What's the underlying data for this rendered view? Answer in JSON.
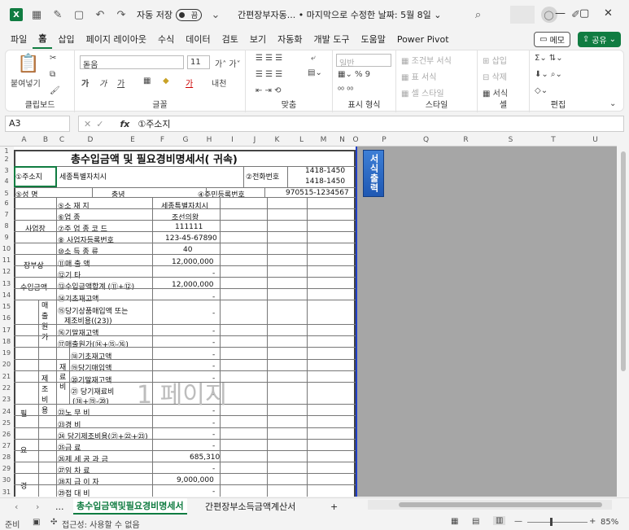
{
  "titlebar": {
    "app_icon": "X",
    "autosave_label": "자동 저장",
    "autosave_state": "끔",
    "doc_title": "간편장부자동... • 마지막으로 수정한 날짜: 5월 8일 ⌄"
  },
  "menu": {
    "tabs": [
      "파일",
      "홈",
      "삽입",
      "페이지 레이아웃",
      "수식",
      "데이터",
      "검토",
      "보기",
      "자동화",
      "개발 도구",
      "도움말",
      "Power Pivot"
    ],
    "memo": "메모",
    "share": "공유"
  },
  "ribbon": {
    "paste": "붙여넣기",
    "clipboard": "클립보드",
    "font_name": "돋움",
    "font_size": "11",
    "font_group": "글꼴",
    "align_group": "맞춤",
    "number_format": "일반",
    "number_group": "표시 형식",
    "cond_format": "조건부 서식",
    "table_format": "표 서식",
    "cell_style": "셀 스타일",
    "style_group": "스타일",
    "insert": "삽입",
    "delete": "삭제",
    "format": "서식",
    "cells_group": "셀",
    "edit_group": "편집"
  },
  "formula": {
    "cell_ref": "A3",
    "fx": "fx",
    "content": "①주소지"
  },
  "columns": [
    "A",
    "B",
    "C",
    "D",
    "E",
    "F",
    "G",
    "H",
    "I",
    "J",
    "K",
    "L",
    "M",
    "N",
    "O",
    "P",
    "Q",
    "R",
    "S",
    "T",
    "U"
  ],
  "rows": [
    "1",
    "2",
    "3",
    "4",
    "5",
    "6",
    "7",
    "8",
    "9",
    "10",
    "11",
    "12",
    "13",
    "14",
    "15",
    "16",
    "17",
    "18",
    "19",
    "20",
    "21",
    "22",
    "23",
    "24",
    "25",
    "26",
    "27",
    "28",
    "29",
    "30",
    "31"
  ],
  "sheet": {
    "title": "총수입금액 및 필요경비명세서(  귀속)",
    "addr_label": "①주소지",
    "addr_value": "세종특별자치시",
    "phone_label": "②전화번호",
    "phone1": "1418-1450",
    "phone2": "1418-1450",
    "name_label": "⑤성  명",
    "name_value": "충녕",
    "rrn_label": "④주민등록번호",
    "rrn_value": "970515-1234567",
    "biz_label": "사업장",
    "r6_label": "⑤소   재   지",
    "r6_value": "세종특별자치시",
    "r7_label": "⑥업        종",
    "r7_value": "조선의왕",
    "r8_label": "⑦주 업 종 코 드",
    "r8_value": "111111",
    "r9_label": "⑧ 사업자등록번호",
    "r9_value": "123-45-67890",
    "r10_label": "⑩소 득 종 류",
    "r10_value": "40",
    "book_label": "장부상",
    "income_label": "수입금액",
    "r11_label": "⑪매     출     액",
    "r11_value": "12,000,000",
    "r12_label": "⑫기          타",
    "r12_value": "-",
    "r13_label": "⑬수입금액합계 (⑪+⑫)",
    "r13_value": "12,000,000",
    "cogs_label": "매출원가",
    "r14_label": "⑭기초재고액",
    "r15_label": "⑮당기상품매입액 또는",
    "r15_label2": "제조비용((23))",
    "r17_label": "⑯기말재고액",
    "r18_label": "⑰매출원가(⑭+⑮-⑯)",
    "mfg_label": "제조비용",
    "mat_label": "재료비",
    "r19_label": "⑱기초재고액",
    "r20_label": "⑲당기매입액",
    "r21_label": "⑳기말재고액",
    "r22_label": "㉑ 당기재료비",
    "r22_label2": "(⑱+⑲-⑳)",
    "r24_label": "㉒노   무   비",
    "r25_label": "㉓경        비",
    "r26_label": "㉔ 당기제조비용(㉑+㉒+㉓)",
    "r27_label": "㉕급        료",
    "r28_label": "㉖제 세 공 과 금",
    "r28_value": "685,310",
    "r29_label": "㉗임    차    료",
    "r30_label": "㉘지 급 이 자",
    "r30_value": "9,000,000",
    "r31_label": "㉙접   대   비",
    "exp_label1": "필",
    "exp_label2": "요",
    "exp_label3": "경",
    "dash": "-",
    "print_button": "서식출력",
    "watermark": "1 페이지"
  },
  "tabs": {
    "sheet1": "총수입금액및필요경비명세서",
    "sheet2": "간편장부소득금액계산서",
    "add": "+",
    "ellipsis": "..."
  },
  "status": {
    "ready": "준비",
    "accessibility": "접근성: 사용할 수 없음",
    "zoom": "85%"
  },
  "colors": {
    "accent": "#107c41",
    "page_border": "#1f3ec7",
    "print_button": "#2a6bc8"
  }
}
